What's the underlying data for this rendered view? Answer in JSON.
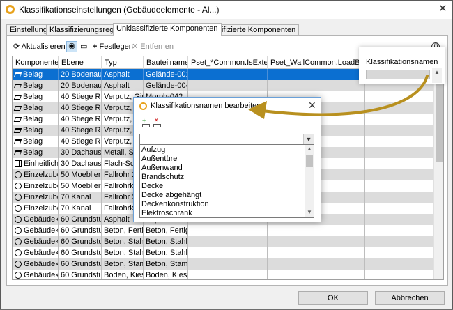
{
  "window": {
    "title": "Klassifikationseinstellungen (Gebäudeelemente - Al...)",
    "close": "✕"
  },
  "tabs": [
    {
      "label": "Einstellungen"
    },
    {
      "label": "Klassifizierungsregeln"
    },
    {
      "label": "Unklassifizierte Komponenten"
    },
    {
      "label": "Klassifizierte Komponenten"
    }
  ],
  "toolbar": {
    "refresh": "Aktualisieren",
    "add": "Festlegen",
    "remove": "Entfernen"
  },
  "grid": {
    "columns": [
      "Komponente",
      "Ebene",
      "Typ",
      "Bauteilname",
      "Pset_*Common.IsExternal",
      "Pset_WallCommon.LoadBearing",
      "Klassifikationsnamen"
    ],
    "rows": [
      {
        "icon": "belag",
        "c": [
          "Belag",
          "20 Bodenauf...",
          "Asphalt",
          "Gelände-001",
          "",
          "",
          ""
        ]
      },
      {
        "icon": "belag",
        "c": [
          "Belag",
          "20 Bodenauf...",
          "Asphalt",
          "Gelände-004",
          "",
          "",
          ""
        ]
      },
      {
        "icon": "belag",
        "c": [
          "Belag",
          "40 Stiege Ra...",
          "Verputz, Gips",
          "Morph-042",
          "",
          "",
          ""
        ]
      },
      {
        "icon": "belag",
        "c": [
          "Belag",
          "40 Stiege Ra...",
          "Verputz, Gips",
          "",
          "",
          "",
          ""
        ]
      },
      {
        "icon": "belag",
        "c": [
          "Belag",
          "40 Stiege Ra...",
          "Verputz, Gips",
          "",
          "",
          "",
          ""
        ]
      },
      {
        "icon": "belag",
        "c": [
          "Belag",
          "40 Stiege Ra...",
          "Verputz, Gips",
          "",
          "",
          "",
          ""
        ]
      },
      {
        "icon": "belag",
        "c": [
          "Belag",
          "40 Stiege Ra...",
          "Verputz, Gips",
          "",
          "",
          "",
          ""
        ]
      },
      {
        "icon": "belag",
        "c": [
          "Belag",
          "30 Dachausbau",
          "Metall, Stahl",
          "",
          "",
          "",
          ""
        ]
      },
      {
        "icon": "grid",
        "c": [
          "Einheitlich...",
          "30 Dachausbau",
          "Flach-Sonn...",
          "",
          "",
          "",
          ""
        ]
      },
      {
        "icon": "circle",
        "c": [
          "Einzelzube...",
          "50 Moeblieru...",
          "Fallrohr 20",
          "",
          "",
          "",
          ""
        ]
      },
      {
        "icon": "circle",
        "c": [
          "Einzelzube...",
          "50 Moeblieru...",
          "Fallrohrkopf",
          "",
          "",
          "",
          ""
        ]
      },
      {
        "icon": "circle",
        "c": [
          "Einzelzube...",
          "70 Kanal",
          "Fallrohr 20",
          "",
          "",
          "",
          ""
        ]
      },
      {
        "icon": "circle",
        "c": [
          "Einzelzube...",
          "70 Kanal",
          "Fallrohrkopf",
          "",
          "",
          "",
          ""
        ]
      },
      {
        "icon": "circle",
        "c": [
          "Gebäudek...",
          "60 Grundstüc...",
          "Asphalt",
          "Asphalt",
          "",
          "",
          ""
        ]
      },
      {
        "icon": "circle",
        "c": [
          "Gebäudek...",
          "60 Grundstüc...",
          "Beton, Fertigt...",
          "Beton, Fertigt...",
          "",
          "",
          ""
        ]
      },
      {
        "icon": "circle",
        "c": [
          "Gebäudek...",
          "60 Grundstüc...",
          "Beton, Stahlb...",
          "Beton, Stahlb...",
          "",
          "",
          ""
        ]
      },
      {
        "icon": "circle",
        "c": [
          "Gebäudek...",
          "60 Grundstüc...",
          "Beton, Stahlb...",
          "Beton, Stahlb...",
          "",
          "",
          ""
        ]
      },
      {
        "icon": "circle",
        "c": [
          "Gebäudek...",
          "60 Grundstüc...",
          "Beton, Stamp...",
          "Beton, Stamp...",
          "",
          "",
          ""
        ]
      },
      {
        "icon": "circle",
        "c": [
          "Gebäudek...",
          "60 Grundstüc...",
          "Boden, Kies",
          "Boden, Kies",
          "",
          "",
          ""
        ]
      }
    ]
  },
  "dialog": {
    "title": "Klassifikationsnamen bearbeiten",
    "close": "✕",
    "options": [
      "Aufzug",
      "Außentüre",
      "Außenwand",
      "Brandschutz",
      "Decke",
      "Decke abgehängt",
      "Deckenkonstruktion",
      "Elektroschrank"
    ]
  },
  "footer": {
    "ok": "OK",
    "cancel": "Abbrechen"
  },
  "colors": {
    "selection": "#0b6fd1",
    "accent_arrow": "#b8901f",
    "app_icon": "#e8a21c"
  }
}
